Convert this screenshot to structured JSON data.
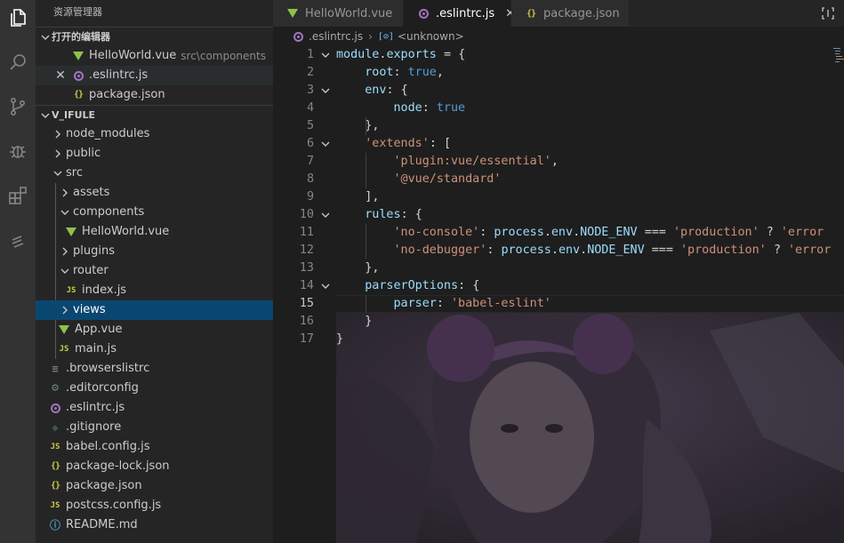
{
  "sidebar": {
    "title": "资源管理器",
    "open_editors": {
      "header": "打开的编辑器",
      "items": [
        {
          "label": "HelloWorld.vue",
          "desc": "src\\components",
          "icon": "vue"
        },
        {
          "label": ".eslintrc.js",
          "desc": "",
          "icon": "eslint"
        },
        {
          "label": "package.json",
          "desc": "",
          "icon": "json"
        }
      ]
    },
    "project": {
      "header": "V_IFULE",
      "items": [
        {
          "label": "node_modules",
          "type": "folder"
        },
        {
          "label": "public",
          "type": "folder"
        },
        {
          "label": "src",
          "type": "folder"
        },
        {
          "label": "assets",
          "type": "folder"
        },
        {
          "label": "components",
          "type": "folder"
        },
        {
          "label": "HelloWorld.vue",
          "icon": "vue"
        },
        {
          "label": "plugins",
          "type": "folder"
        },
        {
          "label": "router",
          "type": "folder"
        },
        {
          "label": "index.js",
          "icon": "js"
        },
        {
          "label": "views",
          "type": "folder"
        },
        {
          "label": "App.vue",
          "icon": "vue"
        },
        {
          "label": "main.js",
          "icon": "js"
        },
        {
          "label": ".browserslistrc",
          "icon": "lines"
        },
        {
          "label": ".editorconfig",
          "icon": "gear"
        },
        {
          "label": ".eslintrc.js",
          "icon": "eslint"
        },
        {
          "label": ".gitignore",
          "icon": "git"
        },
        {
          "label": "babel.config.js",
          "icon": "js"
        },
        {
          "label": "package-lock.json",
          "icon": "json"
        },
        {
          "label": "package.json",
          "icon": "json"
        },
        {
          "label": "postcss.config.js",
          "icon": "js"
        },
        {
          "label": "README.md",
          "icon": "info"
        }
      ]
    }
  },
  "tabs": [
    {
      "label": "HelloWorld.vue",
      "icon": "vue"
    },
    {
      "label": ".eslintrc.js",
      "icon": "eslint",
      "close": "✕"
    },
    {
      "label": "package.json",
      "icon": "json"
    }
  ],
  "icons": {
    "js": "JS",
    "json": "{}",
    "lines": "≡",
    "gear": "⚙",
    "git": "◆",
    "info": "ⓘ",
    "close": "✕",
    "symbol": "[⊘]"
  },
  "breadcrumb": {
    "file": ".eslintrc.js",
    "symbol": "<unknown>"
  },
  "editor": {
    "current_line": 15,
    "lines": [
      {
        "n": "1",
        "code": "module.exports = {"
      },
      {
        "n": "2",
        "code": "    root: true,"
      },
      {
        "n": "3",
        "code": "    env: {"
      },
      {
        "n": "4",
        "code": "        node: true"
      },
      {
        "n": "5",
        "code": "    },"
      },
      {
        "n": "6",
        "code": "    'extends': ["
      },
      {
        "n": "7",
        "code": "        'plugin:vue/essential',"
      },
      {
        "n": "8",
        "code": "        '@vue/standard'"
      },
      {
        "n": "9",
        "code": "    ],"
      },
      {
        "n": "10",
        "code": "    rules: {"
      },
      {
        "n": "11",
        "code": "        'no-console': process.env.NODE_ENV === 'production' ? 'error"
      },
      {
        "n": "12",
        "code": "        'no-debugger': process.env.NODE_ENV === 'production' ? 'error"
      },
      {
        "n": "13",
        "code": "    },"
      },
      {
        "n": "14",
        "code": "    parserOptions: {"
      },
      {
        "n": "15",
        "code": "        parser: 'babel-eslint'"
      },
      {
        "n": "16",
        "code": "    }"
      },
      {
        "n": "17",
        "code": "}"
      }
    ]
  },
  "colors": {
    "accent": "#094771",
    "vue": "#8dc149",
    "js": "#cbcb41",
    "eslint": "#a074c4"
  }
}
